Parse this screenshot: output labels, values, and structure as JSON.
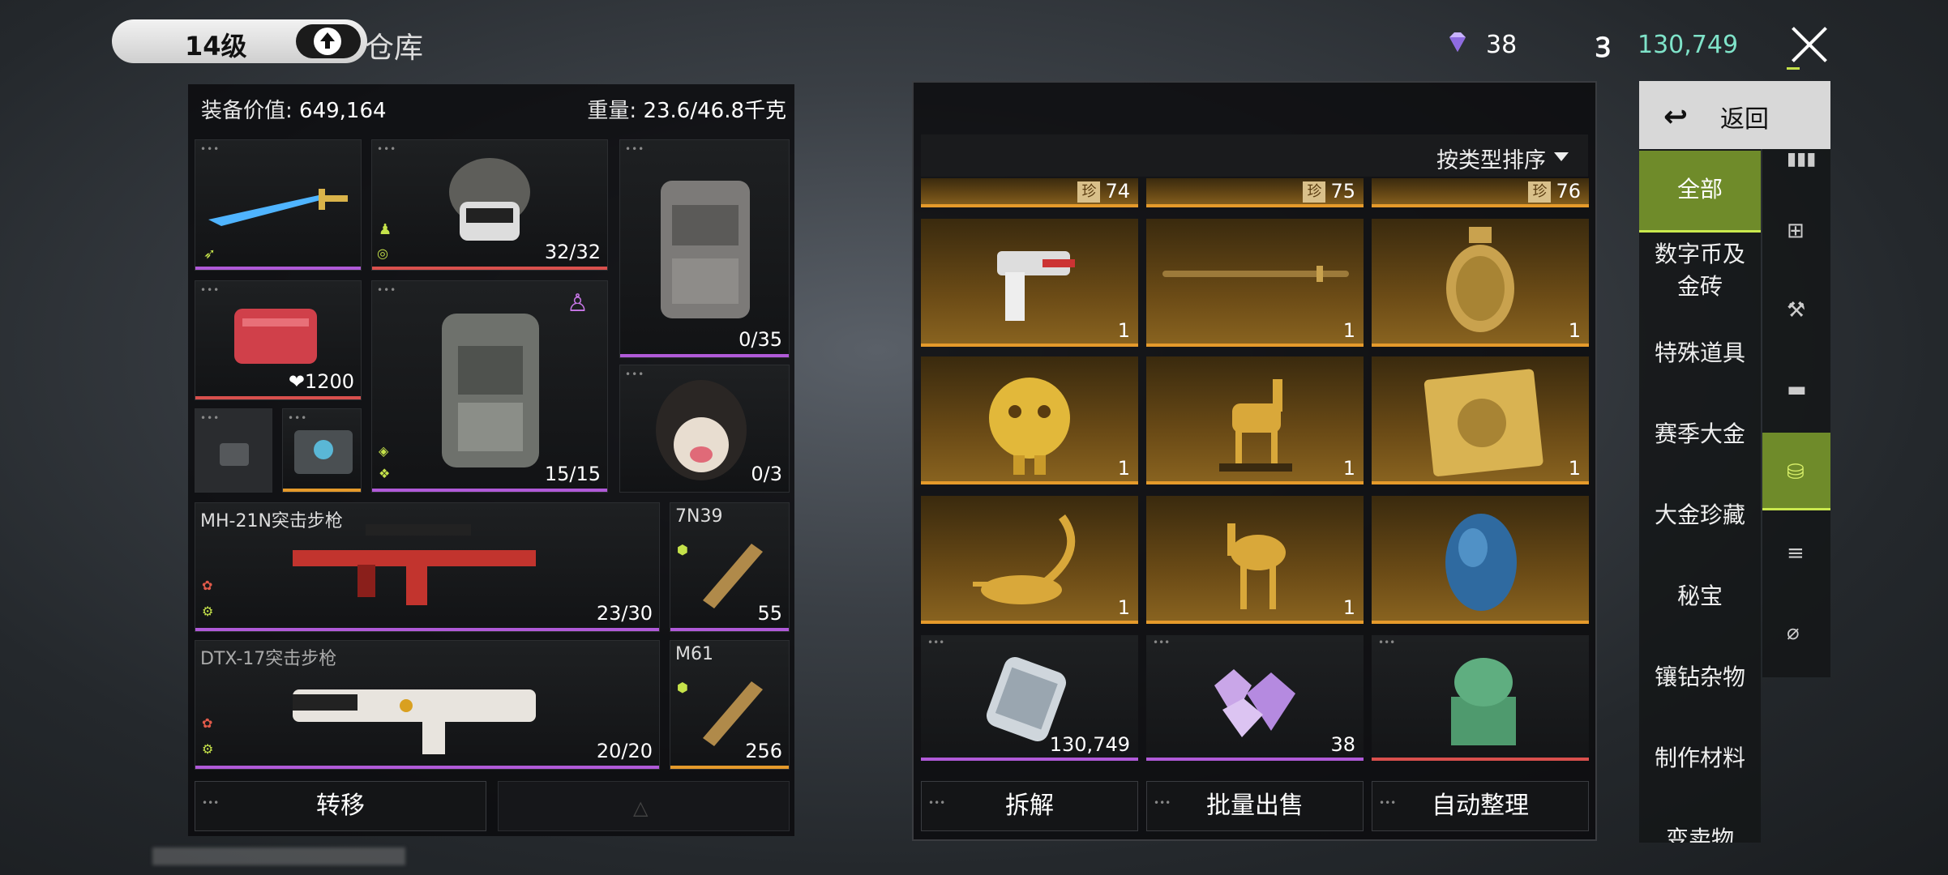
{
  "header": {
    "level": "14级",
    "title": "仓库",
    "diamonds": "38",
    "coins": "130,749"
  },
  "loadout": {
    "value_label": "装备价值:",
    "value": "649,164",
    "weight_label": "重量:",
    "weight": "23.6/46.8千克",
    "helmet_count": "32/32",
    "backpack_count": "0/35",
    "medkit_value": "❤1200",
    "armor_count": "15/15",
    "pet_count": "0/3",
    "weapon1_name": "MH-21N突击步枪",
    "weapon1_ammo": "23/30",
    "weapon2_name": "DTX-17突击步枪",
    "weapon2_ammo": "20/20",
    "ammo1_name": "7N39",
    "ammo1_count": "55",
    "ammo2_name": "M61",
    "ammo2_count": "256",
    "transfer_button": "转移"
  },
  "storage": {
    "sort_label": "按类型排序",
    "top_row": [
      "74",
      "75",
      "76"
    ],
    "gold_items": [
      {
        "name": "gold-gun",
        "count": "1"
      },
      {
        "name": "gold-sword",
        "count": "1"
      },
      {
        "name": "gold-vase",
        "count": "1"
      },
      {
        "name": "gold-figurine",
        "count": "1"
      },
      {
        "name": "gold-deer",
        "count": "1"
      },
      {
        "name": "gold-document",
        "count": "1"
      },
      {
        "name": "gold-scorpion",
        "count": "1"
      },
      {
        "name": "gold-camel",
        "count": "1"
      },
      {
        "name": "blue-egg",
        "count": ""
      }
    ],
    "cash_count": "130,749",
    "gems_count": "38",
    "buttons": {
      "dismantle": "拆解",
      "bulk_sell": "批量出售",
      "auto_sort": "自动整理"
    }
  },
  "sidebar": {
    "back": "返回",
    "categories": [
      "全部",
      "数字币及金砖",
      "特殊道具",
      "赛季大金",
      "大金珍藏",
      "秘宝",
      "镶钻杂物",
      "制作材料",
      "变卖物"
    ]
  },
  "colors": {
    "accent_green": "#c9e84e",
    "rarity_gold": "#e59a2b",
    "rarity_purple": "#b05ad8",
    "rarity_red": "#d9504d",
    "coin_text": "#7fe3c9"
  }
}
